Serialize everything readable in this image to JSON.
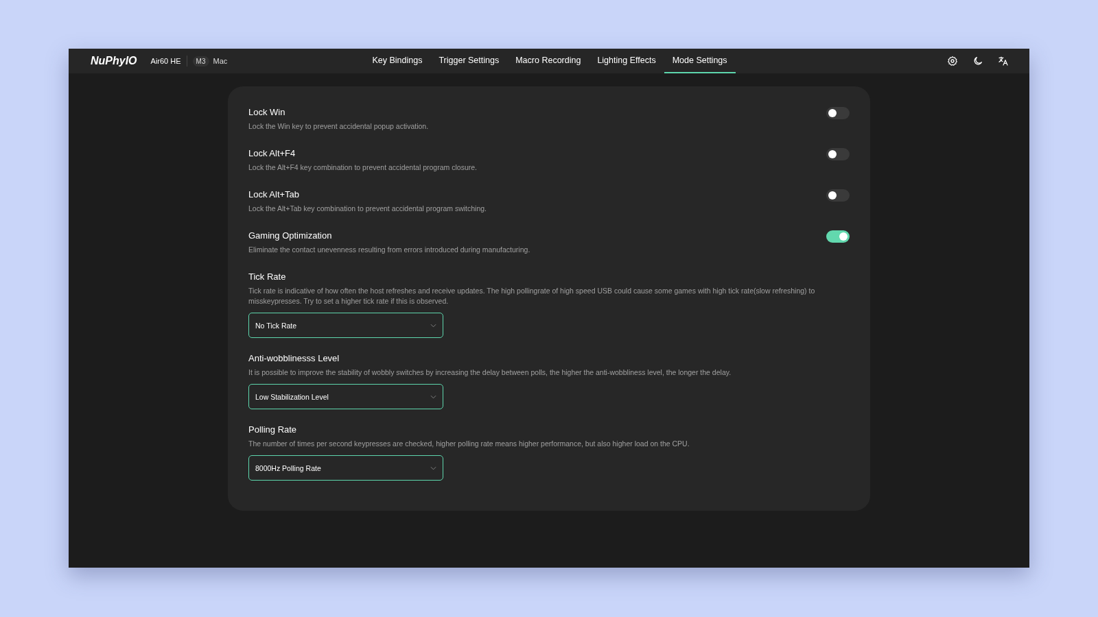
{
  "header": {
    "brand": "NuPhyIO",
    "device": "Air60 HE",
    "chip": "M3",
    "os": "Mac"
  },
  "tabs": [
    {
      "label": "Key Bindings",
      "selected": false
    },
    {
      "label": "Trigger Settings",
      "selected": false
    },
    {
      "label": "Macro Recording",
      "selected": false
    },
    {
      "label": "Lighting Effects",
      "selected": false
    },
    {
      "label": "Mode Settings",
      "selected": true
    }
  ],
  "settings": [
    {
      "kind": "toggle",
      "title": "Lock Win",
      "description": "Lock the Win key to prevent accidental popup activation.",
      "on": false
    },
    {
      "kind": "toggle",
      "title": "Lock Alt+F4",
      "description": "Lock the Alt+F4 key combination to prevent accidental program closure.",
      "on": false
    },
    {
      "kind": "toggle",
      "title": "Lock Alt+Tab",
      "description": "Lock the Alt+Tab key combination to prevent accidental program switching.",
      "on": false
    },
    {
      "kind": "toggle",
      "title": "Gaming Optimization",
      "description": "Eliminate the contact unevenness resulting from errors introduced during manufacturing.",
      "on": true
    },
    {
      "kind": "select",
      "title": "Tick Rate",
      "description": "Tick rate is indicative of how often the host refreshes and receive updates. The high pollingrate of high speed USB could cause some games with high tick rate(slow refreshing) to misskeypresses. Try to set a higher tick rate if this is observed.",
      "value": "No Tick Rate"
    },
    {
      "kind": "select",
      "title": "Anti-wobblinesss Level",
      "description": "It is possible to improve the stability of wobbly switches by increasing the delay between polls, the higher the anti-wobbliness level, the longer the delay.",
      "value": "Low Stabilization Level"
    },
    {
      "kind": "select",
      "title": "Polling Rate",
      "description": "The number of times per second keypresses are checked, higher polling rate means higher performance, but also higher load on the CPU.",
      "value": "8000Hz Polling Rate"
    }
  ]
}
